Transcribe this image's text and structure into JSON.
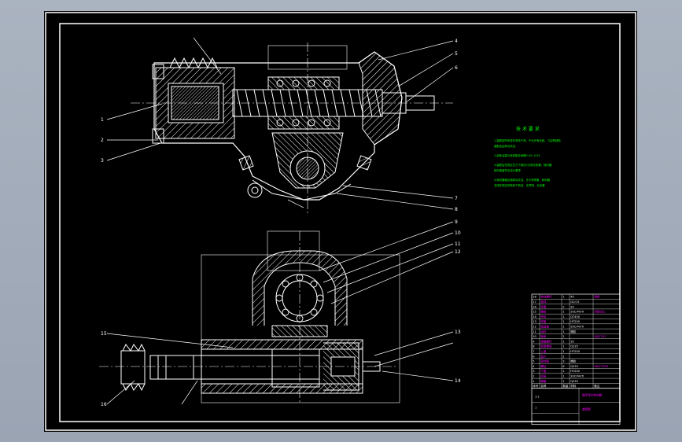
{
  "drawing": {
    "border_color": "#ffffff",
    "line_color": "#ffffff",
    "note_color": "#00ff00",
    "table_accent_color": "#ff00ff"
  },
  "notes": {
    "title": "技 术 要 求",
    "lines": [
      "1.装配前所有零件清洗干净，不允许有毛刺、飞边等缺陷",
      "  装配后应转动灵活",
      "2.齿条活塞与壳体配合间隙0.03~0.05",
      "3.装配后在规定压力下保压5分钟无渗漏，转向器",
      "  转向角度符合设计要求",
      "4.转向器输出轴转动灵活，无卡滞现象，转向器",
      "  总成在规定的转矩下转动，无异响，无渗漏"
    ]
  },
  "parts_table": {
    "rows": [
      [
        "18",
        "转向螺杆",
        "1",
        "45",
        "调质"
      ],
      [
        "17",
        "钢球",
        "",
        "GCr15",
        ""
      ],
      [
        "16",
        "导管",
        "2",
        "20",
        ""
      ],
      [
        "15",
        "螺母",
        "1",
        "20CrMnTi",
        "渗碳淬火"
      ],
      [
        "14",
        "壳体",
        "1",
        "QT450",
        ""
      ],
      [
        "13",
        "侧盖",
        "1",
        "HT200",
        ""
      ],
      [
        "12",
        "摇臂轴",
        "1",
        "20CrMnTi",
        ""
      ],
      [
        "11",
        "油封",
        "1",
        "橡胶",
        ""
      ],
      [
        "10",
        "轴承",
        "2",
        "",
        "GB/T297"
      ],
      [
        "9",
        "调整螺钉",
        "1",
        "35",
        ""
      ],
      [
        "8",
        "锁紧螺母",
        "1",
        "Q235",
        ""
      ],
      [
        "7",
        "上盖",
        "1",
        "HT200",
        ""
      ],
      [
        "6",
        "垫片",
        "2",
        "",
        ""
      ],
      [
        "5",
        "密封圈",
        "3",
        "橡胶",
        ""
      ],
      [
        "4",
        "螺栓",
        "6",
        "Q235",
        "GB/T5783"
      ],
      [
        "3",
        "下盖",
        "1",
        "HT200",
        ""
      ],
      [
        "2",
        "齿扇",
        "1",
        "20CrMnTi",
        ""
      ],
      [
        "1",
        "螺塞",
        "1",
        "Q235",
        ""
      ]
    ],
    "header": [
      "序号",
      "名称",
      "数量",
      "材料",
      "备注"
    ],
    "title_block": {
      "name": "循环球式转向器",
      "drawing_no": "装配图",
      "scale": "1:1",
      "sheet": "1"
    }
  },
  "leaders": {
    "top_left": [
      "1",
      "2",
      "3"
    ],
    "top_right": [
      "4",
      "5",
      "6"
    ],
    "mid_right": [
      "7",
      "8"
    ],
    "bottom_right": [
      "9",
      "10",
      "11",
      "12",
      "13",
      "14"
    ],
    "bottom_left": [
      "15",
      "16"
    ]
  }
}
